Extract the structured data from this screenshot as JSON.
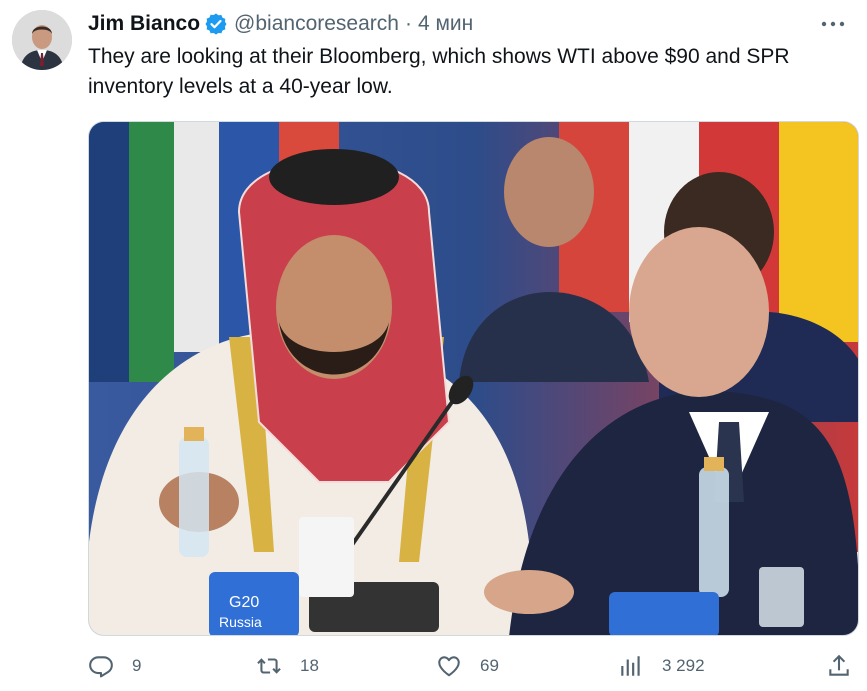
{
  "author": {
    "name": "Jim Bianco",
    "handle": "@biancoresearch",
    "separator": "·",
    "time": "4 мин",
    "verified": true
  },
  "tweet": {
    "text": "They are looking at their Bloomberg, which shows WTI above $90 and SPR inventory levels at a 40-year low."
  },
  "media": {
    "description_icon": "photo",
    "placard_logo": "G20",
    "placard_text": "Russia"
  },
  "actions": {
    "replies": "9",
    "retweets": "18",
    "likes": "69",
    "views": "3 292"
  },
  "colors": {
    "verified": "#1d9bf0",
    "secondary_text": "#536471",
    "primary_text": "#0f1419"
  },
  "icons": {
    "more": "more-icon",
    "reply": "reply-icon",
    "retweet": "retweet-icon",
    "like": "heart-icon",
    "views": "views-icon",
    "share": "share-icon"
  }
}
